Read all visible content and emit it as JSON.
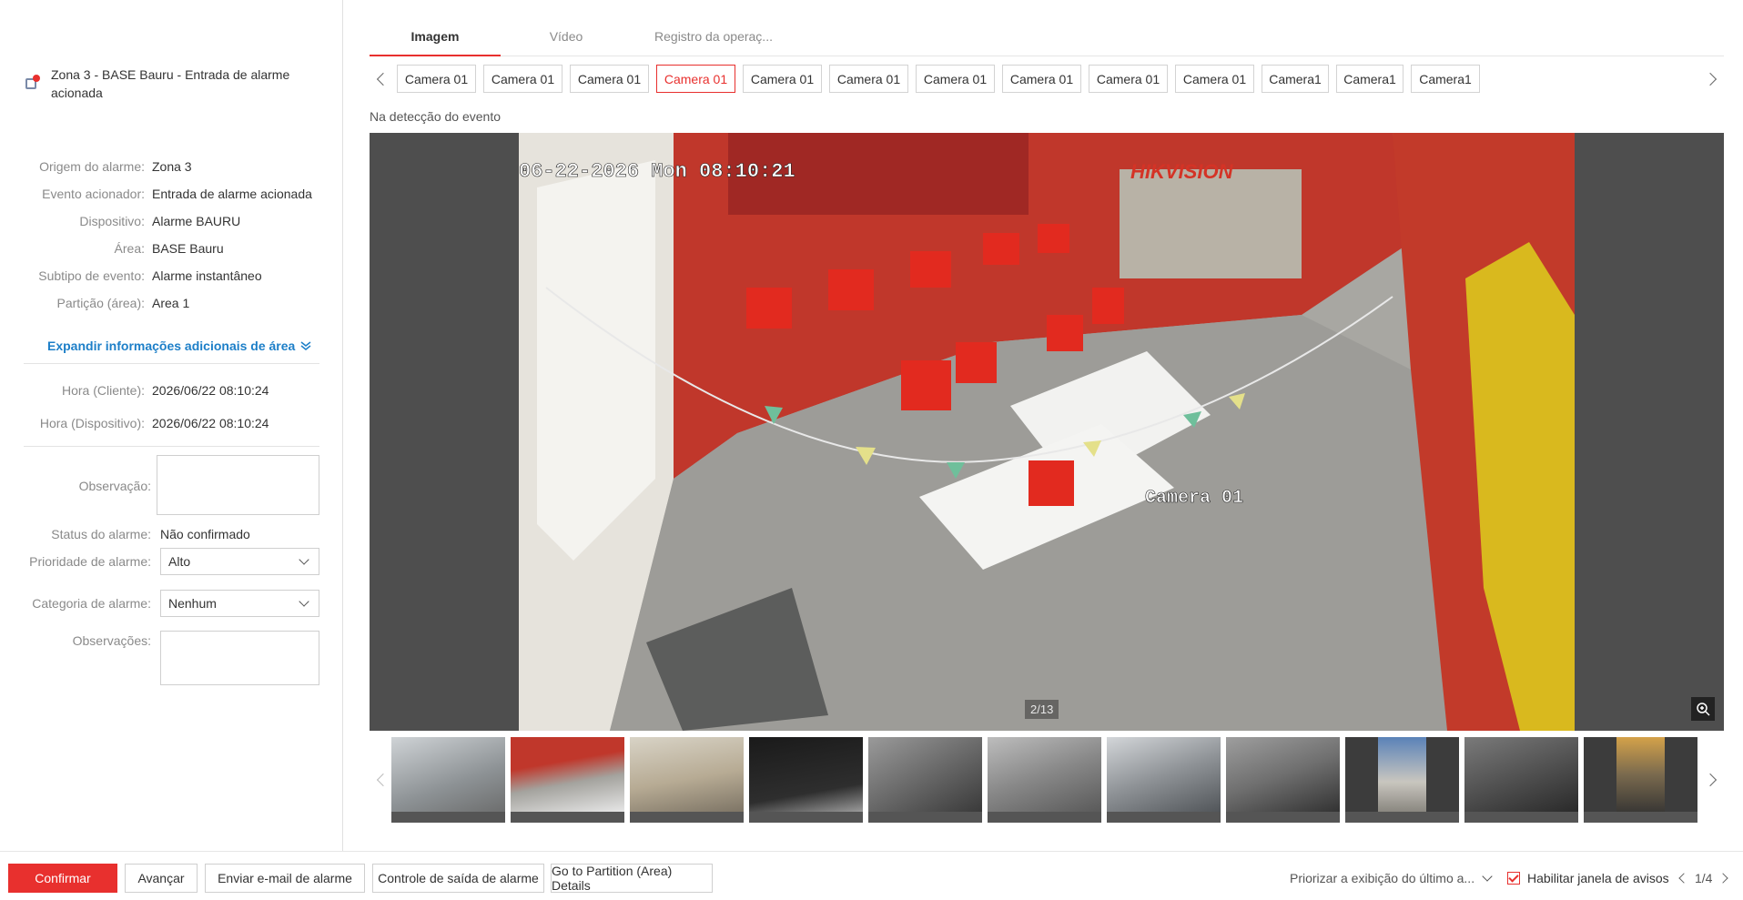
{
  "alarm": {
    "title": "Zona 3 - BASE Bauru - Entrada de alarme acionada",
    "info": [
      {
        "label": "Origem do alarme:",
        "value": "Zona 3"
      },
      {
        "label": "Evento acionador:",
        "value": "Entrada de alarme acionada"
      },
      {
        "label": "Dispositivo:",
        "value": "Alarme BAURU"
      },
      {
        "label": "Área:",
        "value": "BASE Bauru"
      },
      {
        "label": "Subtipo de evento:",
        "value": "Alarme instantâneo"
      },
      {
        "label": "Partição (área):",
        "value": "Area 1"
      }
    ],
    "expand_link": "Expandir informações adicionais de área",
    "times": [
      {
        "label": "Hora (Cliente):",
        "value": "2026/06/22 08:10:24"
      },
      {
        "label": "Hora (Dispositivo):",
        "value": "2026/06/22 08:10:24"
      }
    ]
  },
  "form": {
    "observacao_label": "Observação:",
    "observacao_value": "",
    "status_label": "Status do alarme:",
    "status_value": "Não confirmado",
    "prioridade_label": "Prioridade de alarme:",
    "prioridade_value": "Alto",
    "categoria_label": "Categoria de alarme:",
    "categoria_value": "Nenhum",
    "observacoes_label": "Observações:",
    "observacoes_value": ""
  },
  "tabs": [
    "Imagem",
    "Vídeo",
    "Registro da operaç..."
  ],
  "cameras": [
    "Camera 01",
    "Camera 01",
    "Camera 01",
    "Camera 01",
    "Camera 01",
    "Camera 01",
    "Camera 01",
    "Camera 01",
    "Camera 01",
    "Camera 01",
    "Camera1",
    "Camera1",
    "Camera1"
  ],
  "active_camera_index": 3,
  "detect_label": "Na detecção do evento",
  "viewer": {
    "osd_time": "06-22-2026 Mon 08:10:21",
    "osd_brand": "HIKVISION",
    "osd_camera": "Camera 01",
    "counter": "2/13"
  },
  "footer": {
    "confirm": "Confirmar",
    "advance": "Avançar",
    "email": "Enviar e-mail de alarme",
    "output_control": "Controle de saída de alarme",
    "partition": "Go to Partition (Area) Details",
    "prioritize": "Priorizar a exibição do último a...",
    "enable_window": "Habilitar janela de avisos",
    "page": "1/4"
  },
  "colors": {
    "accent": "#e8302e",
    "link": "#1d7fc8"
  }
}
